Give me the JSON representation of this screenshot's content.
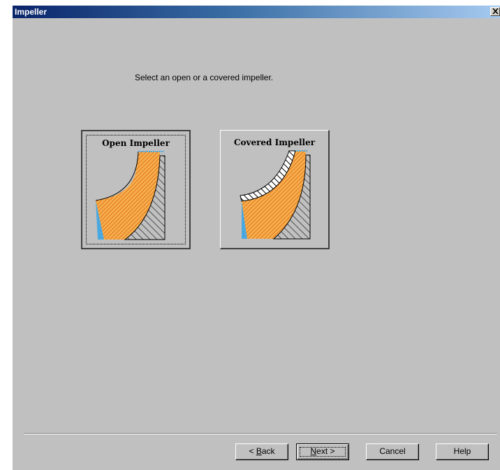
{
  "window": {
    "title": "Impeller"
  },
  "prompt": "Select an open or a covered impeller.",
  "choices": {
    "open": {
      "label": "Open Impeller",
      "selected": true
    },
    "covered": {
      "label": "Covered Impeller",
      "selected": false
    }
  },
  "buttons": {
    "back": {
      "prefix": "< ",
      "mnemonic": "B",
      "rest": "ack"
    },
    "next": {
      "mnemonic": "N",
      "rest": "ext >"
    },
    "cancel": "Cancel",
    "help": "Help"
  },
  "icons": {
    "close": "close-icon",
    "open_impeller": "open-impeller-icon",
    "covered_impeller": "covered-impeller-icon"
  },
  "colors": {
    "dialog_bg": "#c0c0c0",
    "title_gradient_start": "#0a246a",
    "title_gradient_end": "#a6caf0",
    "impeller_fill": "#f0a030",
    "impeller_hatch": "#e06020",
    "inlet_blue": "#4aa8e0"
  }
}
